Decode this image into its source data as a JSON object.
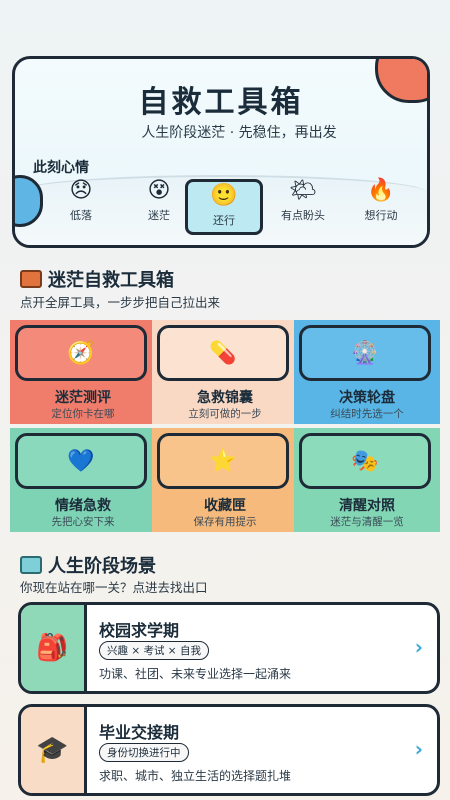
{
  "hero": {
    "title": "自救工具箱",
    "subtitle": "人生阶段迷茫 · 先稳住，再出发",
    "mood_label": "此刻心情",
    "moods": [
      {
        "emoji": "😞",
        "label": "低落",
        "selected": false
      },
      {
        "emoji": "😵",
        "label": "迷茫",
        "selected": false
      },
      {
        "emoji": "🙂",
        "label": "还行",
        "selected": true
      },
      {
        "emoji": "🌤",
        "label": "有点盼头",
        "selected": false
      },
      {
        "emoji": "🔥",
        "label": "想行动",
        "selected": false
      }
    ]
  },
  "toolbox": {
    "title": "迷茫自救工具箱",
    "icon": "toolbox-icon",
    "subtitle": "点开全屏工具，一步步把自己拉出来",
    "tools": [
      {
        "icon": "compass-icon",
        "glyph": "🧭",
        "title": "迷茫测评",
        "desc": "定位你卡在哪",
        "bg": "#f07d6c",
        "inner": "#f48a79"
      },
      {
        "icon": "capsule-icon",
        "glyph": "💊",
        "title": "急救锦囊",
        "desc": "立刻可做的一步",
        "bg": "#f9d9c4",
        "inner": "#fbe2d1"
      },
      {
        "icon": "wheel-icon",
        "glyph": "🎡",
        "title": "决策轮盘",
        "desc": "纠结时先选一个",
        "bg": "#58b5e5",
        "inner": "#66bde9"
      },
      {
        "icon": "heart-icon",
        "glyph": "💙",
        "title": "情绪急救",
        "desc": "先把心安下来",
        "bg": "#7fd3b5",
        "inner": "#8ad9bd"
      },
      {
        "icon": "star-icon",
        "glyph": "⭐",
        "title": "收藏匣",
        "desc": "保存有用提示",
        "bg": "#f6ba7c",
        "inner": "#f8c48c"
      },
      {
        "icon": "masks-icon",
        "glyph": "🎭",
        "title": "清醒对照",
        "desc": "迷茫与清醒一览",
        "bg": "#82d6b4",
        "inner": "#8cdbbb"
      }
    ]
  },
  "stages": {
    "title": "人生阶段场景",
    "icon": "signpost-icon",
    "subtitle": "你现在站在哪一关？点进去找出口",
    "items": [
      {
        "icon": "backpack-icon",
        "glyph": "🎒",
        "title": "校园求学期",
        "tag": "兴趣 × 考试 × 自我",
        "desc": "功课、社团、未来专业选择一起涌来",
        "thumb_bg": "#8fd8b8"
      },
      {
        "icon": "graduation-cap-icon",
        "glyph": "🎓",
        "title": "毕业交接期",
        "tag": "身份切换进行中",
        "desc": "求职、城市、独立生活的选择题扎堆",
        "thumb_bg": "#f9dcc6"
      }
    ]
  },
  "colors": {
    "accent": "#3aa7d6",
    "outline": "#1f2a37",
    "coral": "#f07a5f"
  }
}
